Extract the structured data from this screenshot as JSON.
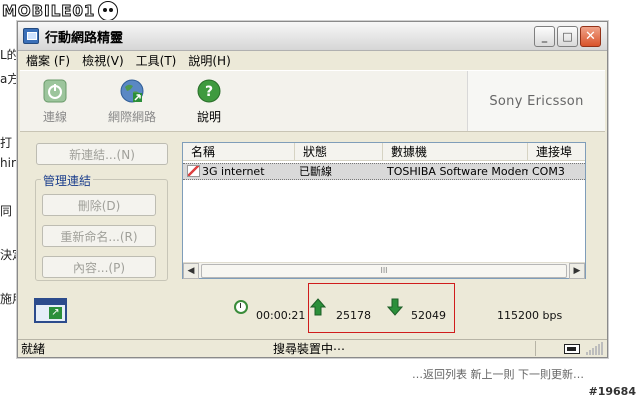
{
  "background": {
    "logo_text": "MOBILE01",
    "side_fragments": [
      "L的",
      "a方",
      "打",
      "hir",
      "同",
      "決定",
      "施用"
    ],
    "bottom_fragment": "…返回列表  新上一則  下一則更新…",
    "post_id": "#19684"
  },
  "window": {
    "title": "行動網路精靈",
    "controls": {
      "minimize": "_",
      "maximize": "□",
      "close": "✕"
    },
    "menu": [
      "檔案 (F)",
      "檢視(V)",
      "工具(T)",
      "說明(H)"
    ],
    "toolbar": [
      {
        "label": "連線",
        "icon": "power-icon",
        "enabled": false
      },
      {
        "label": "網際網路",
        "icon": "globe-icon",
        "enabled": false
      },
      {
        "label": "說明",
        "icon": "help-icon",
        "enabled": true
      }
    ],
    "brand": "Sony Ericsson",
    "new_connection_button": "新連結...(N)",
    "manage_group": {
      "title": "管理連結",
      "buttons": [
        "刪除(D)",
        "重新命名...(R)",
        "內容...(P)"
      ]
    },
    "list": {
      "columns": [
        "名稱",
        "狀態",
        "數據機",
        "連接埠"
      ],
      "rows": [
        {
          "name": "3G internet",
          "status": "已斷線",
          "modem": "TOSHIBA Software Modem",
          "port": "COM3"
        }
      ],
      "scroll_glyph": "III"
    },
    "stats": {
      "elapsed": "00:00:21",
      "sent": "25178",
      "received": "52049",
      "speed": "115200 bps"
    },
    "status": {
      "left": "就緒",
      "middle": "搜尋裝置中⋯",
      "signal_bars": 5
    },
    "colors": {
      "highlight": "#d01c1c",
      "arrow_green": "#2b8f3a",
      "brand_gray": "#666666"
    }
  }
}
